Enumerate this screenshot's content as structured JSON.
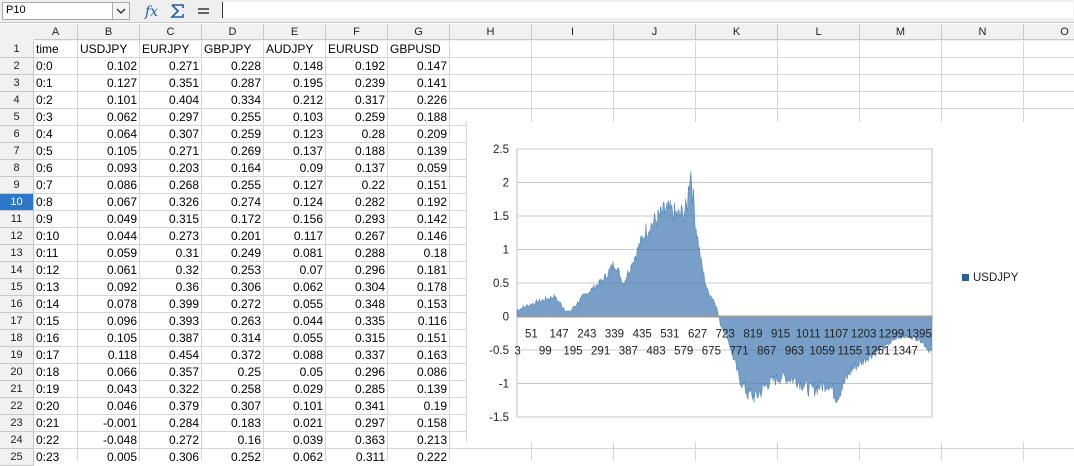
{
  "formula_bar": {
    "name_box": "P10",
    "formula": ""
  },
  "columns": [
    "A",
    "B",
    "C",
    "D",
    "E",
    "F",
    "G",
    "H",
    "I",
    "J",
    "K",
    "L",
    "M",
    "N",
    "O"
  ],
  "rows": [
    "1",
    "2",
    "3",
    "4",
    "5",
    "6",
    "7",
    "8",
    "9",
    "10",
    "11",
    "12",
    "13",
    "14",
    "15",
    "16",
    "17",
    "18",
    "19",
    "20",
    "21",
    "22",
    "23",
    "24",
    "25"
  ],
  "selected_row": "10",
  "table": {
    "header": [
      "time",
      "USDJPY",
      "EURJPY",
      "GBPJPY",
      "AUDJPY",
      "EURUSD",
      "GBPUSD"
    ],
    "data": [
      [
        "0:0",
        "0.102",
        "0.271",
        "0.228",
        "0.148",
        "0.192",
        "0.147"
      ],
      [
        "0:1",
        "0.127",
        "0.351",
        "0.287",
        "0.195",
        "0.239",
        "0.141"
      ],
      [
        "0:2",
        "0.101",
        "0.404",
        "0.334",
        "0.212",
        "0.317",
        "0.226"
      ],
      [
        "0:3",
        "0.062",
        "0.297",
        "0.255",
        "0.103",
        "0.259",
        "0.188"
      ],
      [
        "0:4",
        "0.064",
        "0.307",
        "0.259",
        "0.123",
        "0.28",
        "0.209"
      ],
      [
        "0:5",
        "0.105",
        "0.271",
        "0.269",
        "0.137",
        "0.188",
        "0.139"
      ],
      [
        "0:6",
        "0.093",
        "0.203",
        "0.164",
        "0.09",
        "0.137",
        "0.059"
      ],
      [
        "0:7",
        "0.086",
        "0.268",
        "0.255",
        "0.127",
        "0.22",
        "0.151"
      ],
      [
        "0:8",
        "0.067",
        "0.326",
        "0.274",
        "0.124",
        "0.282",
        "0.192"
      ],
      [
        "0:9",
        "0.049",
        "0.315",
        "0.172",
        "0.156",
        "0.293",
        "0.142"
      ],
      [
        "0:10",
        "0.044",
        "0.273",
        "0.201",
        "0.117",
        "0.267",
        "0.146"
      ],
      [
        "0:11",
        "0.059",
        "0.31",
        "0.249",
        "0.081",
        "0.288",
        "0.18"
      ],
      [
        "0:12",
        "0.061",
        "0.32",
        "0.253",
        "0.07",
        "0.296",
        "0.181"
      ],
      [
        "0:13",
        "0.092",
        "0.36",
        "0.306",
        "0.062",
        "0.304",
        "0.178"
      ],
      [
        "0:14",
        "0.078",
        "0.399",
        "0.272",
        "0.055",
        "0.348",
        "0.153"
      ],
      [
        "0:15",
        "0.096",
        "0.393",
        "0.263",
        "0.044",
        "0.335",
        "0.116"
      ],
      [
        "0:16",
        "0.105",
        "0.387",
        "0.314",
        "0.055",
        "0.315",
        "0.151"
      ],
      [
        "0:17",
        "0.118",
        "0.454",
        "0.372",
        "0.088",
        "0.337",
        "0.163"
      ],
      [
        "0:18",
        "0.066",
        "0.357",
        "0.25",
        "0.05",
        "0.296",
        "0.086"
      ],
      [
        "0:19",
        "0.043",
        "0.322",
        "0.258",
        "0.029",
        "0.285",
        "0.139"
      ],
      [
        "0:20",
        "0.046",
        "0.379",
        "0.307",
        "0.101",
        "0.341",
        "0.19"
      ],
      [
        "0:21",
        "-0.001",
        "0.284",
        "0.183",
        "0.021",
        "0.297",
        "0.158"
      ],
      [
        "0:22",
        "-0.048",
        "0.272",
        "0.16",
        "0.039",
        "0.363",
        "0.213"
      ],
      [
        "0:23",
        "0.005",
        "0.306",
        "0.252",
        "0.062",
        "0.311",
        "0.222"
      ]
    ]
  },
  "chart_data": {
    "type": "area",
    "ylim": [
      -1.5,
      2.5
    ],
    "yticks": [
      "2.5",
      "2",
      "1.5",
      "1",
      "0.5",
      "0",
      "-0.5",
      "-1",
      "-1.5"
    ],
    "xlabels_row1": [
      "51",
      "147",
      "243",
      "339",
      "435",
      "531",
      "627",
      "723",
      "819",
      "915",
      "1011",
      "1107",
      "1203",
      "1299",
      "1395"
    ],
    "xlabels_row2": [
      "3",
      "99",
      "195",
      "291",
      "387",
      "483",
      "579",
      "675",
      "771",
      "867",
      "963",
      "1059",
      "1155",
      "1251",
      "1347"
    ],
    "xrange": [
      1,
      1440
    ],
    "series": [
      {
        "name": "USDJPY",
        "color": "#4a7fb5",
        "profile": [
          [
            1,
            0.1
          ],
          [
            60,
            0.2
          ],
          [
            130,
            0.3
          ],
          [
            180,
            0.05
          ],
          [
            230,
            0.3
          ],
          [
            300,
            0.55
          ],
          [
            340,
            0.8
          ],
          [
            370,
            0.5
          ],
          [
            400,
            0.8
          ],
          [
            450,
            1.3
          ],
          [
            520,
            1.6
          ],
          [
            560,
            1.5
          ],
          [
            590,
            1.6
          ],
          [
            602,
            2.25
          ],
          [
            620,
            1.4
          ],
          [
            640,
            0.8
          ],
          [
            660,
            0.4
          ],
          [
            690,
            0.2
          ],
          [
            705,
            -0.1
          ],
          [
            730,
            -0.3
          ],
          [
            770,
            -0.9
          ],
          [
            800,
            -1.15
          ],
          [
            830,
            -1.2
          ],
          [
            870,
            -1.0
          ],
          [
            920,
            -0.9
          ],
          [
            970,
            -0.95
          ],
          [
            1020,
            -1.1
          ],
          [
            1080,
            -1.0
          ],
          [
            1110,
            -1.2
          ],
          [
            1160,
            -0.8
          ],
          [
            1220,
            -0.6
          ],
          [
            1280,
            -0.45
          ],
          [
            1320,
            -0.3
          ],
          [
            1370,
            -0.3
          ],
          [
            1400,
            -0.35
          ],
          [
            1440,
            -0.55
          ]
        ]
      }
    ]
  }
}
